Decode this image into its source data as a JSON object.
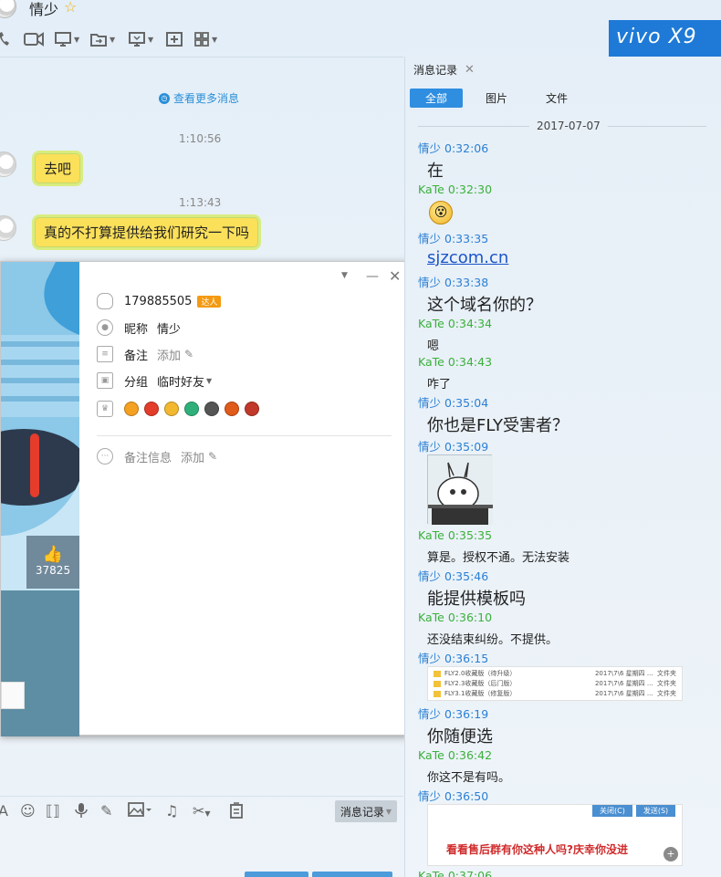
{
  "header": {
    "contact_name": "情少",
    "brand_banner": "vivo X9",
    "tools": [
      "phone-icon",
      "video-icon",
      "screen-share-icon",
      "file-transfer-icon",
      "remote-desktop-icon",
      "add-icon",
      "apps-icon"
    ]
  },
  "chat": {
    "more_messages": "查看更多消息",
    "messages": [
      {
        "time": "1:10:56",
        "text": "去吧"
      },
      {
        "time": "1:13:43",
        "text": "真的不打算提供给我们研究一下吗"
      }
    ]
  },
  "input_toolbar": {
    "history_button": "消息记录",
    "tools": [
      "font-icon",
      "emoji-icon",
      "shake-icon",
      "voice-icon",
      "draw-icon",
      "image-icon",
      "music-icon",
      "screenshot-icon",
      "clear-icon"
    ]
  },
  "profile_card": {
    "qq_number": "179885505",
    "badge": "达人",
    "like_count": "37825",
    "nickname_label": "昵称",
    "nickname": "情少",
    "remark_label": "备注",
    "remark_value": "添加",
    "group_label": "分组",
    "group_value": "临时好友",
    "remark_info_label": "备注信息",
    "remark_info_value": "添加",
    "emblem_colors": [
      "#f4a020",
      "#e33c2a",
      "#f2b830",
      "#2fb07a",
      "#555555",
      "#e05a1a",
      "#c0392b"
    ]
  },
  "history": {
    "tab_label": "消息记录",
    "filters": [
      "全部",
      "图片",
      "文件"
    ],
    "date": "2017-07-07",
    "entries": [
      {
        "sender": "情少",
        "time": "0:32:06",
        "text": "在"
      },
      {
        "sender": "KaTe",
        "time": "0:32:30",
        "text": ""
      },
      {
        "sender": "情少",
        "time": "0:33:35",
        "text": "sjzcom.cn"
      },
      {
        "sender": "情少",
        "time": "0:33:38",
        "text": "这个域名你的？"
      },
      {
        "sender": "KaTe",
        "time": "0:34:34",
        "text": "嗯"
      },
      {
        "sender": "KaTe",
        "time": "0:34:43",
        "text": "咋了"
      },
      {
        "sender": "情少",
        "time": "0:35:04",
        "text": "你也是FLY受害者？"
      },
      {
        "sender": "情少",
        "time": "0:35:09",
        "text": ""
      },
      {
        "sender": "KaTe",
        "time": "0:35:35",
        "text": "算是。授权不通。无法安装"
      },
      {
        "sender": "情少",
        "time": "0:35:46",
        "text": "能提供模板吗"
      },
      {
        "sender": "KaTe",
        "time": "0:36:10",
        "text": "还没结束纠纷。不提供。"
      },
      {
        "sender": "情少",
        "time": "0:36:15",
        "text": ""
      },
      {
        "sender": "情少",
        "time": "0:36:19",
        "text": "你随便选"
      },
      {
        "sender": "KaTe",
        "time": "0:36:42",
        "text": "你这不是有吗。"
      },
      {
        "sender": "情少",
        "time": "0:36:50",
        "text": ""
      },
      {
        "sender": "KaTe",
        "time": "0:37:06",
        "text": ""
      }
    ],
    "file_list": [
      {
        "name": "FLY2.0收藏版（待升级）",
        "date": "2017\\7\\6 星期四 ...",
        "type": "文件夹"
      },
      {
        "name": "FLY2.3收藏版（后门版）",
        "date": "2017\\7\\6 星期四 ...",
        "type": "文件夹"
      },
      {
        "name": "FLY3.1收藏版（修复版）",
        "date": "2017\\7\\6 星期四 ...",
        "type": "文件夹"
      }
    ],
    "warn_shot": {
      "close_btn": "关闭(C)",
      "send_btn": "发送(S)",
      "text": "看看售后群有你这种人吗?庆幸你没进"
    }
  }
}
